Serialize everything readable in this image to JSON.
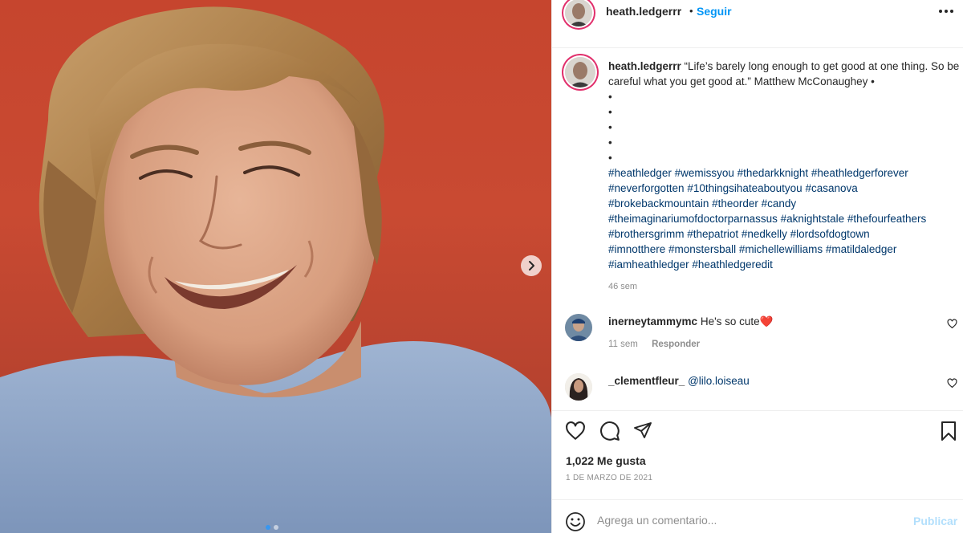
{
  "post": {
    "username": "heath.ledgerrr",
    "separator": "•",
    "follow_label": "Seguir",
    "more_icon": "more-options-icon",
    "media": {
      "next_icon": "chevron-right-icon",
      "slides": 2,
      "active_slide": 1
    },
    "caption": {
      "username": "heath.ledgerrr",
      "quote": "“Life’s barely long enough to get good at one thing. So be careful what you get good at.” Matthew McConaughey •",
      "bullets": [
        "•",
        "•",
        "•",
        "•",
        "•"
      ],
      "hashtags_line1": "#heathledger #wemissyou #thedarkknight #heathledgerforever",
      "hashtags_line2": "#neverforgotten #10thingsihateaboutyou #casanova",
      "hashtags_line3": "#brokebackmountain #theorder #candy",
      "hashtags_line4": "#theimaginariumofdoctorparnassus #aknightstale #thefourfeathers",
      "hashtags_line5": "#brothersgrimm #thepatriot #nedkelly #lordsofdogtown",
      "hashtags_line6": "#imnotthere #monstersball #michellewilliams #matildaledger",
      "hashtags_line7": "#iamheathledger #heathledgeredit",
      "time": "46 sem"
    },
    "comments": [
      {
        "username": "inerneytammymc",
        "text": "He's so cute",
        "emoji": "❤️",
        "time": "11 sem",
        "reply_label": "Responder"
      },
      {
        "username": "_clementfleur_",
        "text": "@lilo.loiseau"
      }
    ],
    "likes": "1,022 Me gusta",
    "date": "1 DE MARZO DE 2021",
    "comment_placeholder": "Agrega un comentario...",
    "publish_label": "Publicar",
    "colors": {
      "link_blue": "#0095f6",
      "hashtag_blue": "#00376b",
      "muted": "#8e8e8e",
      "publish_disabled": "#b2dffc",
      "background_red": "#c6452e",
      "shirt_blue": "#8ea6c7"
    }
  }
}
